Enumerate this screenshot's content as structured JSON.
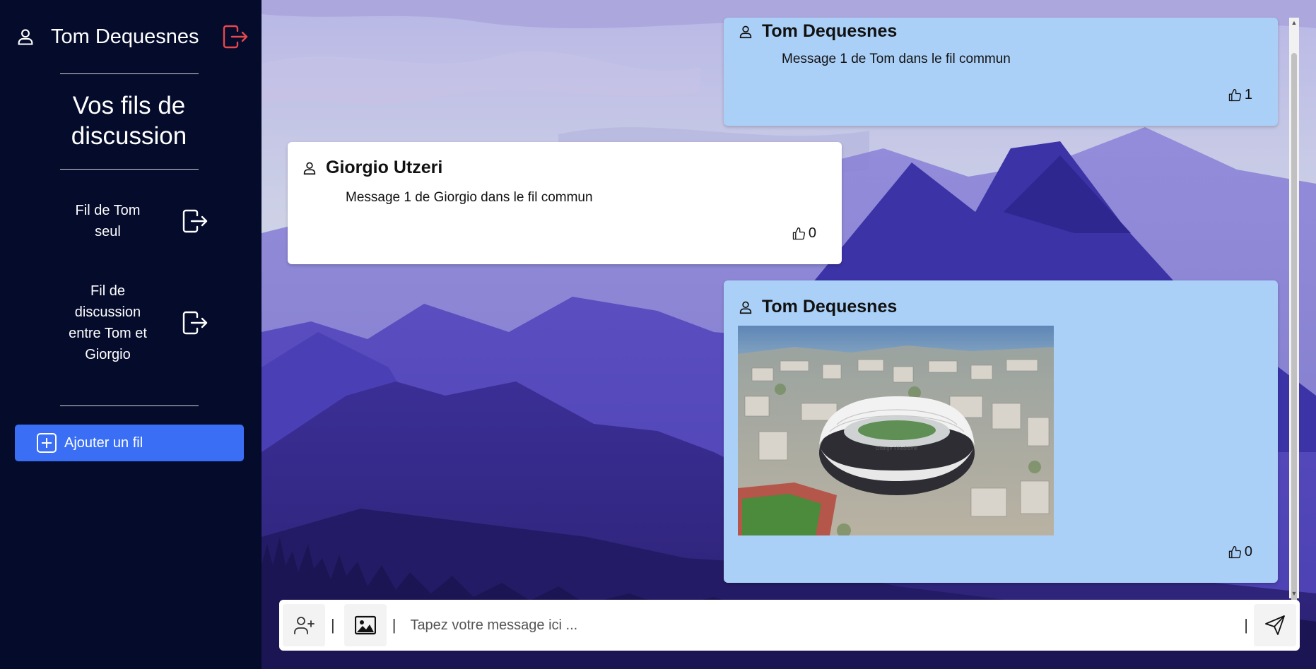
{
  "sidebar": {
    "user_name": "Tom Dequesnes",
    "title": "Vos fils de discussion",
    "threads": [
      {
        "label": "Fil de Tom seul"
      },
      {
        "label": "Fil de discussion entre Tom et Giorgio"
      }
    ],
    "add_thread_label": "Ajouter un fil"
  },
  "messages": [
    {
      "author": "Tom Dequesnes",
      "text": "Message 1 de Tom dans le fil commun",
      "likes": "1",
      "own": true
    },
    {
      "author": "Giorgio Utzeri",
      "text": "Message 1 de Giorgio dans le fil commun",
      "likes": "0",
      "own": false
    },
    {
      "author": "Tom Dequesnes",
      "image_text": "Orange Vélodrome",
      "likes": "0",
      "own": true
    }
  ],
  "composer": {
    "placeholder": "Tapez votre message ici ...",
    "separator": "|"
  },
  "colors": {
    "sidebar_bg": "#050b2b",
    "accent_button": "#3a6ff5",
    "own_message_bg": "#abd0f7",
    "other_message_bg": "#ffffff",
    "logout_icon": "#e5484d"
  },
  "icons": [
    "user-icon",
    "logout-icon",
    "enter-thread-icon",
    "plus-icon",
    "thumbs-up-icon",
    "add-user-icon",
    "image-icon",
    "send-icon"
  ]
}
